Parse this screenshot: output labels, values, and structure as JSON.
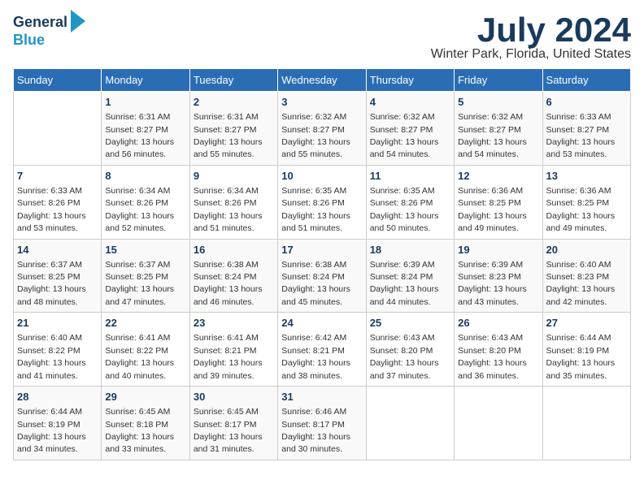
{
  "header": {
    "logo_line1": "General",
    "logo_line2": "Blue",
    "month": "July 2024",
    "location": "Winter Park, Florida, United States"
  },
  "days_of_week": [
    "Sunday",
    "Monday",
    "Tuesday",
    "Wednesday",
    "Thursday",
    "Friday",
    "Saturday"
  ],
  "weeks": [
    [
      {
        "day": "",
        "sunrise": "",
        "sunset": "",
        "daylight": ""
      },
      {
        "day": "1",
        "sunrise": "Sunrise: 6:31 AM",
        "sunset": "Sunset: 8:27 PM",
        "daylight": "Daylight: 13 hours and 56 minutes."
      },
      {
        "day": "2",
        "sunrise": "Sunrise: 6:31 AM",
        "sunset": "Sunset: 8:27 PM",
        "daylight": "Daylight: 13 hours and 55 minutes."
      },
      {
        "day": "3",
        "sunrise": "Sunrise: 6:32 AM",
        "sunset": "Sunset: 8:27 PM",
        "daylight": "Daylight: 13 hours and 55 minutes."
      },
      {
        "day": "4",
        "sunrise": "Sunrise: 6:32 AM",
        "sunset": "Sunset: 8:27 PM",
        "daylight": "Daylight: 13 hours and 54 minutes."
      },
      {
        "day": "5",
        "sunrise": "Sunrise: 6:32 AM",
        "sunset": "Sunset: 8:27 PM",
        "daylight": "Daylight: 13 hours and 54 minutes."
      },
      {
        "day": "6",
        "sunrise": "Sunrise: 6:33 AM",
        "sunset": "Sunset: 8:27 PM",
        "daylight": "Daylight: 13 hours and 53 minutes."
      }
    ],
    [
      {
        "day": "7",
        "sunrise": "Sunrise: 6:33 AM",
        "sunset": "Sunset: 8:26 PM",
        "daylight": "Daylight: 13 hours and 53 minutes."
      },
      {
        "day": "8",
        "sunrise": "Sunrise: 6:34 AM",
        "sunset": "Sunset: 8:26 PM",
        "daylight": "Daylight: 13 hours and 52 minutes."
      },
      {
        "day": "9",
        "sunrise": "Sunrise: 6:34 AM",
        "sunset": "Sunset: 8:26 PM",
        "daylight": "Daylight: 13 hours and 51 minutes."
      },
      {
        "day": "10",
        "sunrise": "Sunrise: 6:35 AM",
        "sunset": "Sunset: 8:26 PM",
        "daylight": "Daylight: 13 hours and 51 minutes."
      },
      {
        "day": "11",
        "sunrise": "Sunrise: 6:35 AM",
        "sunset": "Sunset: 8:26 PM",
        "daylight": "Daylight: 13 hours and 50 minutes."
      },
      {
        "day": "12",
        "sunrise": "Sunrise: 6:36 AM",
        "sunset": "Sunset: 8:25 PM",
        "daylight": "Daylight: 13 hours and 49 minutes."
      },
      {
        "day": "13",
        "sunrise": "Sunrise: 6:36 AM",
        "sunset": "Sunset: 8:25 PM",
        "daylight": "Daylight: 13 hours and 49 minutes."
      }
    ],
    [
      {
        "day": "14",
        "sunrise": "Sunrise: 6:37 AM",
        "sunset": "Sunset: 8:25 PM",
        "daylight": "Daylight: 13 hours and 48 minutes."
      },
      {
        "day": "15",
        "sunrise": "Sunrise: 6:37 AM",
        "sunset": "Sunset: 8:25 PM",
        "daylight": "Daylight: 13 hours and 47 minutes."
      },
      {
        "day": "16",
        "sunrise": "Sunrise: 6:38 AM",
        "sunset": "Sunset: 8:24 PM",
        "daylight": "Daylight: 13 hours and 46 minutes."
      },
      {
        "day": "17",
        "sunrise": "Sunrise: 6:38 AM",
        "sunset": "Sunset: 8:24 PM",
        "daylight": "Daylight: 13 hours and 45 minutes."
      },
      {
        "day": "18",
        "sunrise": "Sunrise: 6:39 AM",
        "sunset": "Sunset: 8:24 PM",
        "daylight": "Daylight: 13 hours and 44 minutes."
      },
      {
        "day": "19",
        "sunrise": "Sunrise: 6:39 AM",
        "sunset": "Sunset: 8:23 PM",
        "daylight": "Daylight: 13 hours and 43 minutes."
      },
      {
        "day": "20",
        "sunrise": "Sunrise: 6:40 AM",
        "sunset": "Sunset: 8:23 PM",
        "daylight": "Daylight: 13 hours and 42 minutes."
      }
    ],
    [
      {
        "day": "21",
        "sunrise": "Sunrise: 6:40 AM",
        "sunset": "Sunset: 8:22 PM",
        "daylight": "Daylight: 13 hours and 41 minutes."
      },
      {
        "day": "22",
        "sunrise": "Sunrise: 6:41 AM",
        "sunset": "Sunset: 8:22 PM",
        "daylight": "Daylight: 13 hours and 40 minutes."
      },
      {
        "day": "23",
        "sunrise": "Sunrise: 6:41 AM",
        "sunset": "Sunset: 8:21 PM",
        "daylight": "Daylight: 13 hours and 39 minutes."
      },
      {
        "day": "24",
        "sunrise": "Sunrise: 6:42 AM",
        "sunset": "Sunset: 8:21 PM",
        "daylight": "Daylight: 13 hours and 38 minutes."
      },
      {
        "day": "25",
        "sunrise": "Sunrise: 6:43 AM",
        "sunset": "Sunset: 8:20 PM",
        "daylight": "Daylight: 13 hours and 37 minutes."
      },
      {
        "day": "26",
        "sunrise": "Sunrise: 6:43 AM",
        "sunset": "Sunset: 8:20 PM",
        "daylight": "Daylight: 13 hours and 36 minutes."
      },
      {
        "day": "27",
        "sunrise": "Sunrise: 6:44 AM",
        "sunset": "Sunset: 8:19 PM",
        "daylight": "Daylight: 13 hours and 35 minutes."
      }
    ],
    [
      {
        "day": "28",
        "sunrise": "Sunrise: 6:44 AM",
        "sunset": "Sunset: 8:19 PM",
        "daylight": "Daylight: 13 hours and 34 minutes."
      },
      {
        "day": "29",
        "sunrise": "Sunrise: 6:45 AM",
        "sunset": "Sunset: 8:18 PM",
        "daylight": "Daylight: 13 hours and 33 minutes."
      },
      {
        "day": "30",
        "sunrise": "Sunrise: 6:45 AM",
        "sunset": "Sunset: 8:17 PM",
        "daylight": "Daylight: 13 hours and 31 minutes."
      },
      {
        "day": "31",
        "sunrise": "Sunrise: 6:46 AM",
        "sunset": "Sunset: 8:17 PM",
        "daylight": "Daylight: 13 hours and 30 minutes."
      },
      {
        "day": "",
        "sunrise": "",
        "sunset": "",
        "daylight": ""
      },
      {
        "day": "",
        "sunrise": "",
        "sunset": "",
        "daylight": ""
      },
      {
        "day": "",
        "sunrise": "",
        "sunset": "",
        "daylight": ""
      }
    ]
  ]
}
